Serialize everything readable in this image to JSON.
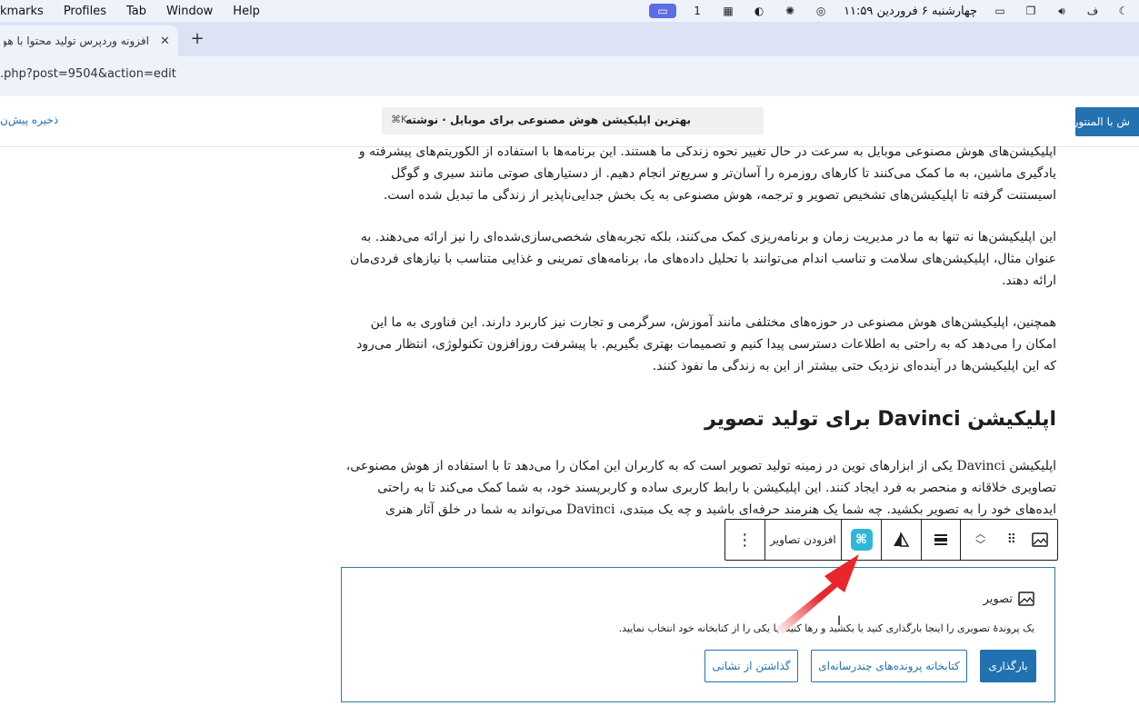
{
  "menubar": {
    "items": [
      "kmarks",
      "Profiles",
      "Tab",
      "Window",
      "Help"
    ],
    "clock": "چهارشنبه ۶ فروردین ۱۱:۵۹",
    "badge": "1"
  },
  "browser": {
    "tab_title": "افزونه وردپرس تولید محتوا با هوش",
    "tab_close": "✕",
    "new_tab": "+",
    "url": ".php?post=9504&action=edit"
  },
  "editor_header": {
    "save_draft": "ذخیره پیش‌ن",
    "doc_title": "بهترین اپلیکیشن هوش مصنوعی برای موبایل · نوشته",
    "shortcut": "⌘K",
    "publish_label": "ش با المنتور"
  },
  "content": {
    "p1": "اپلیکیشن‌های هوش مصنوعی موبایل به سرعت در حال تغییر نحوه زندگی ما هستند. این برنامه‌ها با استفاده از الگوریتم‌های پیشرفته و یادگیری ماشین، به ما کمک می‌کنند تا کارهای روزمره را آسان‌تر و سریع‌تر انجام دهیم. از دستیارهای صوتی مانند سیری و گوگل اسیستنت گرفته تا اپلیکیشن‌های تشخیص تصویر و ترجمه، هوش مصنوعی به یک بخش جدایی‌ناپذیر از زندگی ما تبدیل شده است.",
    "p2": "این اپلیکیشن‌ها نه تنها به ما در مدیریت زمان و برنامه‌ریزی کمک می‌کنند، بلکه تجربه‌های شخصی‌سازی‌شده‌ای را نیز ارائه می‌دهند. به عنوان مثال، اپلیکیشن‌های سلامت و تناسب اندام می‌توانند با تحلیل داده‌های ما، برنامه‌های تمرینی و غذایی متناسب با نیازهای فردی‌مان ارائه دهند.",
    "p3": "همچنین، اپلیکیشن‌های هوش مصنوعی در حوزه‌های مختلفی مانند آموزش، سرگرمی و تجارت نیز کاربرد دارند. این فناوری به ما این امکان را می‌دهد که به راحتی به اطلاعات دسترسی پیدا کنیم و تصمیمات بهتری بگیریم. با پیشرفت روزافزون تکنولوژی، انتظار می‌رود که این اپلیکیشن‌ها در آینده‌ای نزدیک حتی بیشتر از این به زندگی ما نفوذ کنند.",
    "heading": "اپلیکیشن Davinci برای تولید تصویر",
    "p4": "اپلیکیشن Davinci یکی از ابزارهای نوین در زمینه تولید تصویر است که به کاربران این امکان را می‌دهد تا با استفاده از هوش مصنوعی، تصاویری خلاقانه و منحصر به فرد ایجاد کنند. این اپلیکیشن با رابط کاربری ساده و کاربرپسند خود، به شما کمک می‌کند تا به راحتی ایده‌های خود را به تصویر بکشید. چه شما یک هنرمند حرفه‌ای باشید و چه یک مبتدی، Davinci می‌تواند به شما در خلق آثار هنری"
  },
  "block_toolbar": {
    "more": "⋮",
    "add_images": "افزودن تصاویر"
  },
  "image_block": {
    "label": "تصویر",
    "instructions": "یک پروندهٔ تصویری را اینجا بارگذاری کنید یا بکشید و رها کنید، یا یکی را از کتابخانه خود انتخاب نمایید.",
    "upload": "بارگذاری",
    "media_library": "کتابخانه پرونده‌های چندرسانه‌ای",
    "insert_url": "گذاشتن از نشانی"
  },
  "colors": {
    "accent": "#2271b1",
    "ai_icon": "#2fb8d6",
    "arrow": "#e8262b"
  }
}
